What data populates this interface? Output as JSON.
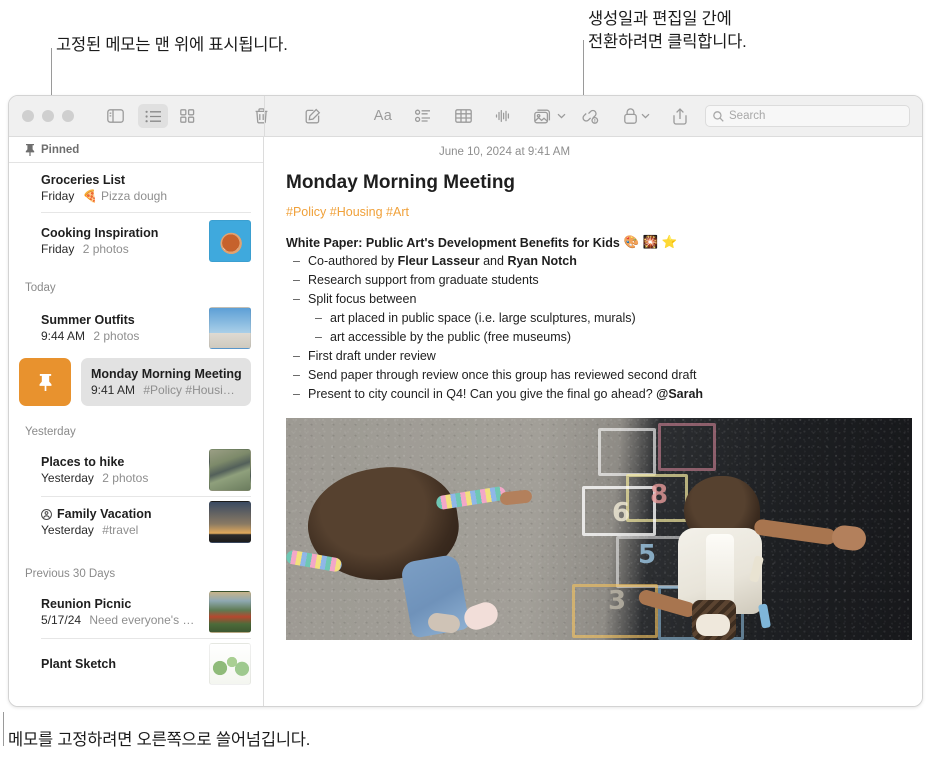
{
  "annotations": {
    "top_left": "고정된 메모는 맨 위에 표시됩니다.",
    "top_right": "생성일과 편집일 간에\n전환하려면 클릭합니다.",
    "bottom_left": "메모를 고정하려면 오른쪽으로 쓸어넘깁니다."
  },
  "toolbar": {
    "sidebar_toggle": "sidebar-toggle",
    "list_view": "list-view",
    "grid_view": "grid-view",
    "delete": "delete",
    "compose": "compose",
    "format": "Aa",
    "checklist": "checklist",
    "table": "table",
    "audio": "audio",
    "media": "media",
    "collaborate": "collaborate",
    "lock": "lock",
    "share": "share",
    "search_placeholder": "Search"
  },
  "sidebar": {
    "pinned_label": "Pinned",
    "groups": [
      {
        "label": "",
        "notes": [
          {
            "title": "Groceries List",
            "date": "Friday",
            "preview": "Pizza dough",
            "emoji": "🍕",
            "thumb": "",
            "shared": false
          },
          {
            "title": "Cooking Inspiration",
            "date": "Friday",
            "preview": "2 photos",
            "emoji": "",
            "thumb": "t-pizza",
            "shared": false
          }
        ]
      },
      {
        "label": "Today",
        "notes": [
          {
            "title": "Summer Outfits",
            "date": "9:44 AM",
            "preview": "2 photos",
            "emoji": "",
            "thumb": "t-outfit",
            "shared": false
          }
        ]
      },
      {
        "label": "Yesterday",
        "notes": [
          {
            "title": "Places to hike",
            "date": "Yesterday",
            "preview": "2 photos",
            "emoji": "",
            "thumb": "t-hike",
            "shared": false
          },
          {
            "title": "Family Vacation",
            "date": "Yesterday",
            "preview": "#travel",
            "emoji": "",
            "thumb": "t-bike",
            "shared": true
          }
        ]
      },
      {
        "label": "Previous 30 Days",
        "notes": [
          {
            "title": "Reunion Picnic",
            "date": "5/17/24",
            "preview": "Need everyone's u…",
            "emoji": "",
            "thumb": "t-picnic",
            "shared": false
          },
          {
            "title": "Plant Sketch",
            "date": "",
            "preview": "",
            "emoji": "",
            "thumb": "t-plant",
            "shared": false
          }
        ]
      }
    ],
    "selected_note": {
      "title": "Monday Morning Meeting",
      "time": "9:41 AM",
      "tags": "#Policy #Housing…",
      "pin_action_label": "pin",
      "pin_action_color": "#E8922E"
    }
  },
  "note": {
    "date": "June 10, 2024 at 9:41 AM",
    "title": "Monday Morning Meeting",
    "tags": "#Policy #Housing #Art",
    "tag_color": "#F0A13A",
    "subheading": "White Paper: Public Art's Development Benefits for Kids",
    "subheading_emoji": "🎨 🎇 ⭐",
    "bullets": [
      {
        "text": "Co-authored by <b>Fleur Lasseur</b> and <b>Ryan Notch</b>",
        "children": []
      },
      {
        "text": "Research support from graduate students",
        "children": []
      },
      {
        "text": "Split focus between",
        "children": [
          "art placed in public space (i.e. large sculptures, murals)",
          "art accessible by the public (free museums)"
        ]
      },
      {
        "text": "First draft under review",
        "children": []
      },
      {
        "text": "Send paper through review once this group has reviewed second draft",
        "children": []
      },
      {
        "text": "Present to city council in Q4! Can you give the final go ahead? <b>@Sarah</b>",
        "children": []
      }
    ],
    "photo_alt": "Two children playing hopscotch on asphalt",
    "chalk_numbers": [
      "8",
      "6",
      "5",
      "3"
    ]
  }
}
